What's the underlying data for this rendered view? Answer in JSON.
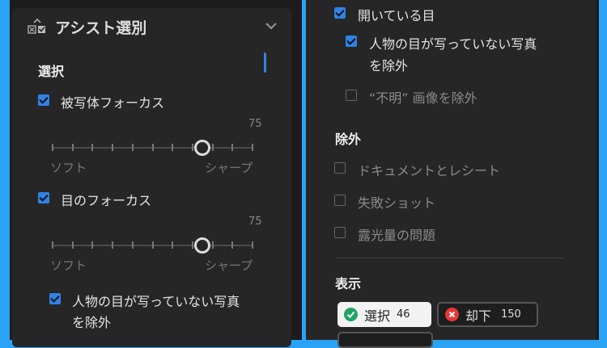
{
  "left": {
    "title": "アシスト選別",
    "section": "選択",
    "subject_focus": {
      "label": "被写体フォーカス",
      "checked": true,
      "value": "75",
      "value_pct": 75,
      "min_label": "ソフト",
      "max_label": "シャープ"
    },
    "eye_focus": {
      "label": "目のフォーカス",
      "checked": true,
      "value": "75",
      "value_pct": 75,
      "min_label": "ソフト",
      "max_label": "シャープ"
    },
    "exclude_no_eyes": {
      "label_line1": "人物の目が写っていない写真",
      "label_line2": "を除外",
      "checked": true
    }
  },
  "right": {
    "open_eyes": {
      "label": "開いている目",
      "checked": true
    },
    "exclude_no_eyes": {
      "label_line1": "人物の目が写っていない写真",
      "label_line2": "を除外",
      "checked": true
    },
    "exclude_unknown": {
      "label": "“不明” 画像を除外",
      "checked": false
    },
    "exclude_section": "除外",
    "exclude_items": [
      {
        "label": "ドキュメントとレシート"
      },
      {
        "label": "失敗ショット"
      },
      {
        "label": "露光量の問題"
      }
    ],
    "show_section": "表示",
    "buttons": [
      {
        "label": "選択",
        "count": "46"
      },
      {
        "label": "却下",
        "count": "150"
      }
    ]
  },
  "colors": {
    "accent": "#2f83e6",
    "select_green": "#1fa463",
    "reject_red": "#e53935"
  }
}
